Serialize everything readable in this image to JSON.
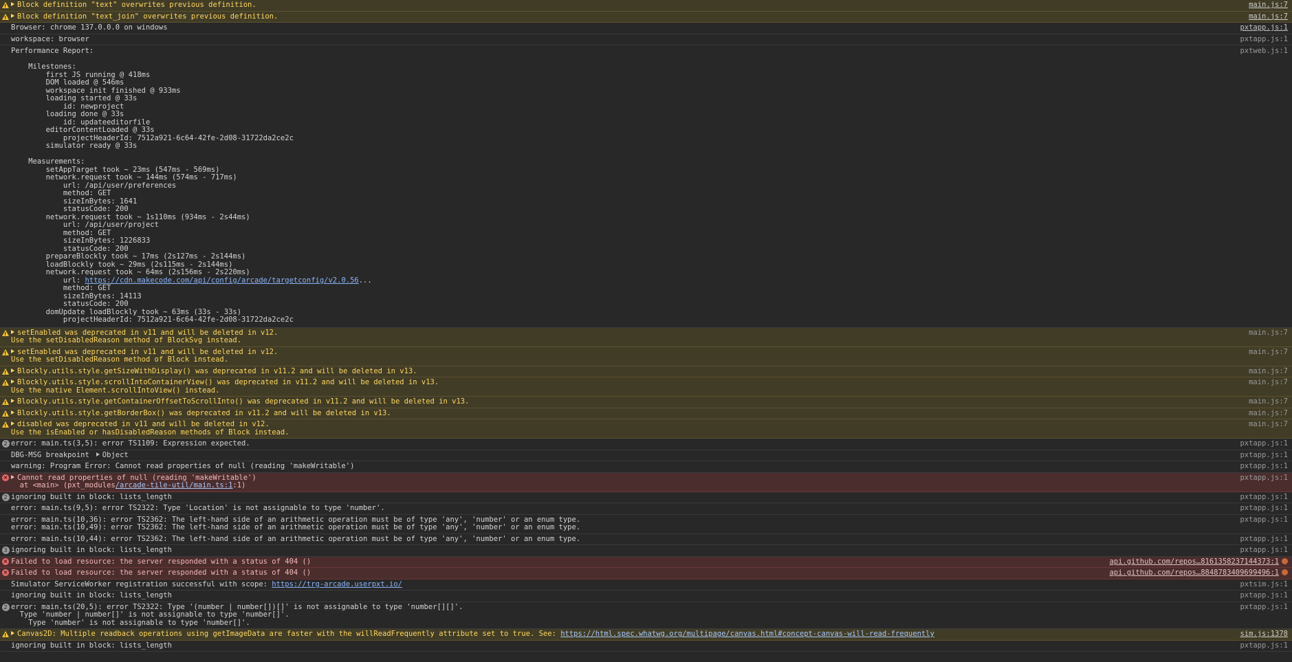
{
  "rows": [
    {
      "level": "warn",
      "expand": true,
      "text": "Block definition \"text\" overwrites previous definition.",
      "src": "main.js:7",
      "srcLink": true
    },
    {
      "level": "warn",
      "expand": true,
      "text": "Block definition \"text_join\" overwrites previous definition.",
      "src": "main.js:7",
      "srcLink": true
    },
    {
      "level": "log",
      "text": "Browser: chrome 137.0.0.0 on windows",
      "src": "pxtapp.js:1",
      "srcLink": true
    },
    {
      "level": "log",
      "text": "workspace: browser",
      "src": "pxtapp.js:1"
    },
    {
      "level": "log",
      "text": "Performance Report:\n\n    Milestones:\n        first JS running @ 418ms\n        DOM loaded @ 546ms\n        workspace init finished @ 933ms\n        loading started @ 33s\n            id: newproject\n        loading done @ 33s\n            id: updateeditorfile\n        editorContentLoaded @ 33s\n            projectHeaderId: 7512a921-6c64-42fe-2d08-31722da2ce2c\n        simulator ready @ 33s\n\n    Measurements:\n        setAppTarget took ~ 23ms (547ms - 569ms)\n        network.request took ~ 144ms (574ms - 717ms)\n            url: /api/user/preferences\n            method: GET\n            sizeInBytes: 1641\n            statusCode: 200\n        network.request took ~ 1s110ms (934ms - 2s44ms)\n            url: /api/user/project\n            method: GET\n            sizeInBytes: 1226833\n            statusCode: 200\n        prepareBlockly took ~ 17ms (2s127ms - 2s144ms)\n        loadBlockly took ~ 29ms (2s115ms - 2s144ms)\n        network.request took ~ 64ms (2s156ms - 2s220ms)",
      "src": "pxtweb.js:1",
      "perf": true,
      "urlPrefix": "            url: ",
      "url": "https://cdn.makecode.com/api/config/arcade/targetconfig/v2.0.56",
      "urlSuffix": "...",
      "tail": "            method: GET\n            sizeInBytes: 14113\n            statusCode: 200\n        domUpdate loadBlockly took ~ 63ms (33s - 33s)\n            projectHeaderId: 7512a921-6c64-42fe-2d08-31722da2ce2c"
    },
    {
      "level": "warn",
      "expand": true,
      "text": "setEnabled was deprecated in v11 and will be deleted in v12.",
      "text2": "Use the setDisabledReason method of BlockSvg instead.",
      "src": "main.js:7"
    },
    {
      "level": "warn",
      "expand": true,
      "text": "setEnabled was deprecated in v11 and will be deleted in v12.",
      "text2": "Use the setDisabledReason method of Block instead.",
      "src": "main.js:7"
    },
    {
      "level": "warn",
      "expand": true,
      "text": "Blockly.utils.style.getSizeWithDisplay() was deprecated in v11.2 and will be deleted in v13.",
      "src": "main.js:7"
    },
    {
      "level": "warn",
      "expand": true,
      "text": "Blockly.utils.style.scrollIntoContainerView() was deprecated in v11.2 and will be deleted in v13.",
      "text2": "Use the native Element.scrollIntoView() instead.",
      "src": "main.js:7"
    },
    {
      "level": "warn",
      "expand": true,
      "text": "Blockly.utils.style.getContainerOffsetToScrollInto() was deprecated in v11.2 and will be deleted in v13.",
      "src": "main.js:7"
    },
    {
      "level": "warn",
      "expand": true,
      "text": "Blockly.utils.style.getBorderBox() was deprecated in v11.2 and will be deleted in v13.",
      "src": "main.js:7"
    },
    {
      "level": "warn",
      "expand": true,
      "text": "disabled was deprecated in v11 and will be deleted in v12.",
      "text2": "Use the isEnabled or hasDisabledReason methods of Block instead.",
      "src": "main.js:7"
    },
    {
      "level": "log",
      "count": "2",
      "text": "error: main.ts(3,5): error TS1109: Expression expected.",
      "src": "pxtapp.js:1"
    },
    {
      "level": "log",
      "text": "DBG-MSG breakpoint",
      "object": "Object",
      "src": "pxtapp.js:1"
    },
    {
      "level": "log",
      "text": "warning: Program Error: Cannot read properties of null (reading 'makeWritable')",
      "src": "pxtapp.js:1"
    },
    {
      "level": "error",
      "expand": true,
      "text": "Cannot read properties of null (reading 'makeWritable')",
      "stackPrefix": "  at <main> (pxt_modules",
      "stackLink": "/arcade-tile-util/main.ts:1",
      "stackSuffix": ":1)",
      "src": "pxtapp.js:1"
    },
    {
      "level": "log",
      "count": "2",
      "text": "ignoring built in block: lists_length",
      "src": "pxtapp.js:1"
    },
    {
      "level": "log",
      "text": "error: main.ts(9,5): error TS2322: Type 'Location' is not assignable to type 'number'.",
      "src": "pxtapp.js:1"
    },
    {
      "level": "log",
      "text": "error: main.ts(10,36): error TS2362: The left-hand side of an arithmetic operation must be of type 'any', 'number' or an enum type.\nerror: main.ts(10,49): error TS2362: The left-hand side of an arithmetic operation must be of type 'any', 'number' or an enum type.",
      "src": "pxtapp.js:1"
    },
    {
      "level": "log",
      "text": "error: main.ts(10,44): error TS2362: The left-hand side of an arithmetic operation must be of type 'any', 'number' or an enum type.",
      "src": "pxtapp.js:1"
    },
    {
      "level": "log",
      "count": "3",
      "text": "ignoring built in block: lists_length",
      "src": "pxtapp.js:1"
    },
    {
      "level": "error",
      "text": "Failed to load resource: the server responded with a status of 404 ()",
      "src": "api.github.com/repos…816135823714437 3:1",
      "srcLink": true,
      "ext": true
    },
    {
      "level": "error",
      "text": "Failed to load resource: the server responded with a status of 404 ()",
      "src": "api.github.com/repos…88487834 09699496:1",
      "srcLink": true,
      "ext": true
    },
    {
      "level": "log",
      "text": "Simulator ServiceWorker registration successful with scope: ",
      "link": "https://trg-arcade.userpxt.io/",
      "src": "pxtsim.js:1"
    },
    {
      "level": "log",
      "text": "ignoring built in block: lists_length",
      "src": "pxtapp.js:1"
    },
    {
      "level": "log",
      "count": "2",
      "text": "error: main.ts(20,5): error TS2322: Type '(number | number[])[]' is not assignable to type 'number[][]'.\n  Type 'number | number[]' is not assignable to type 'number[]'.\n    Type 'number' is not assignable to type 'number[]'.",
      "src": "pxtapp.js:1"
    },
    {
      "level": "warn",
      "expand": true,
      "text": "Canvas2D: Multiple readback operations using getImageData are faster with the willReadFrequently attribute set to true. See: ",
      "link": "https://html.spec.whatwg.org/multipage/canvas.html#concept-canvas-will-read-frequently",
      "src": "sim.js:1378",
      "srcLink": true
    },
    {
      "level": "log",
      "text": "ignoring built in block: lists_length",
      "src": "pxtapp.js:1"
    }
  ]
}
